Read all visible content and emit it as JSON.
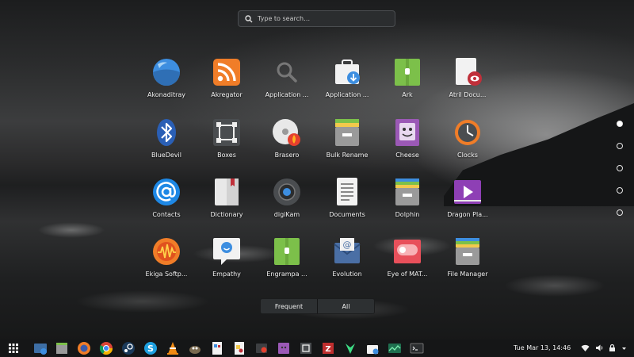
{
  "search": {
    "placeholder": "Type to search…"
  },
  "apps": [
    {
      "label": "Akonaditray",
      "icon": "akonaditray-icon"
    },
    {
      "label": "Akregator",
      "icon": "akregator-rss-icon"
    },
    {
      "label": "Application ...",
      "icon": "application-finder-icon"
    },
    {
      "label": "Application ...",
      "icon": "application-installer-icon"
    },
    {
      "label": "Ark",
      "icon": "ark-archive-icon"
    },
    {
      "label": "Atril Docu...",
      "icon": "atril-document-viewer-icon"
    },
    {
      "label": "BlueDevil",
      "icon": "bluetooth-icon"
    },
    {
      "label": "Boxes",
      "icon": "boxes-icon"
    },
    {
      "label": "Brasero",
      "icon": "brasero-disc-burner-icon"
    },
    {
      "label": "Bulk Rename",
      "icon": "bulk-rename-icon"
    },
    {
      "label": "Cheese",
      "icon": "cheese-webcam-icon"
    },
    {
      "label": "Clocks",
      "icon": "clocks-icon"
    },
    {
      "label": "Contacts",
      "icon": "contacts-at-icon"
    },
    {
      "label": "Dictionary",
      "icon": "dictionary-icon"
    },
    {
      "label": "digiKam",
      "icon": "digikam-camera-icon"
    },
    {
      "label": "Documents",
      "icon": "documents-icon"
    },
    {
      "label": "Dolphin",
      "icon": "dolphin-file-manager-icon"
    },
    {
      "label": "Dragon Pla...",
      "icon": "dragon-player-icon"
    },
    {
      "label": "Ekiga Softp...",
      "icon": "ekiga-softphone-icon"
    },
    {
      "label": "Empathy",
      "icon": "empathy-chat-icon"
    },
    {
      "label": "Engrampa ...",
      "icon": "engrampa-archive-icon"
    },
    {
      "label": "Evolution",
      "icon": "evolution-mail-icon"
    },
    {
      "label": "Eye of MAT...",
      "icon": "eye-of-mate-image-icon"
    },
    {
      "label": "File Manager",
      "icon": "file-manager-icon"
    }
  ],
  "pager": {
    "pages": 5,
    "active": 0
  },
  "view_toggle": {
    "frequent": "Frequent",
    "all": "All",
    "selected": "All"
  },
  "taskbar": {
    "launcher": "app-grid-icon",
    "apps": [
      "screenshot-tool-icon",
      "files-icon",
      "firefox-icon",
      "chrome-icon",
      "steam-icon",
      "skype-icon",
      "vlc-icon",
      "gimp-icon",
      "writer-icon",
      "draw-icon",
      "emulator-icon",
      "screen-capture-icon",
      "filezilla-icon",
      "android-studio-icon",
      "software-center-icon",
      "system-monitor-icon",
      "terminal-icon"
    ],
    "clock": "Tue Mar 13, 14:46",
    "tray": [
      "wifi-icon",
      "volume-icon",
      "lock-icon",
      "power-icon"
    ]
  },
  "colors": {
    "accent_blue": "#3d8ee0",
    "orange": "#f07d28",
    "green": "#7cc04a",
    "purple": "#9b59b6",
    "red": "#e8505b",
    "taskbar_bg": "#151617"
  }
}
